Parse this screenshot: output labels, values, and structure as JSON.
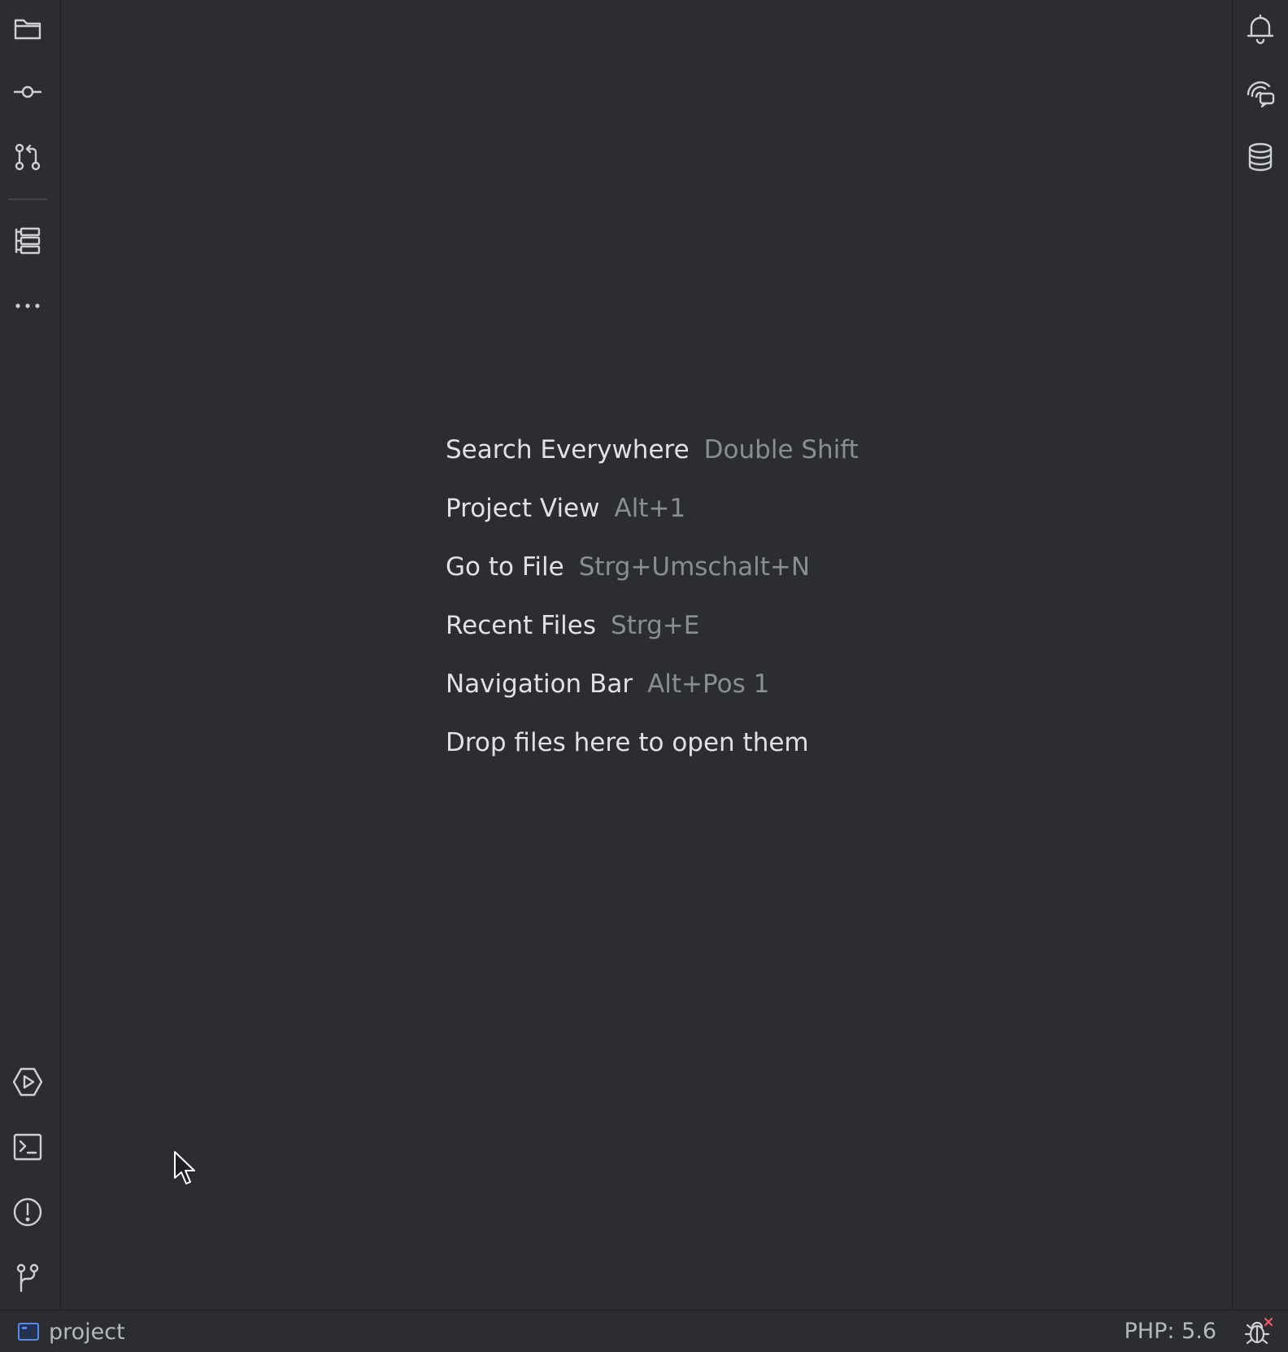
{
  "left_toolbar": {
    "top": [
      {
        "name": "project-folder-icon",
        "label": "Project"
      },
      {
        "name": "commit-icon",
        "label": "Commit"
      },
      {
        "name": "pull-requests-icon",
        "label": "Pull Requests"
      },
      {
        "name": "structure-icon",
        "label": "Structure"
      },
      {
        "name": "more-icon",
        "label": "More tool windows"
      }
    ],
    "bottom": [
      {
        "name": "services-icon",
        "label": "Services"
      },
      {
        "name": "terminal-icon",
        "label": "Terminal"
      },
      {
        "name": "problems-icon",
        "label": "Problems"
      },
      {
        "name": "git-icon",
        "label": "Git"
      }
    ]
  },
  "right_toolbar": [
    {
      "name": "notifications-icon",
      "label": "Notifications"
    },
    {
      "name": "ai-assistant-icon",
      "label": "AI Assistant"
    },
    {
      "name": "database-icon",
      "label": "Database"
    }
  ],
  "editor": {
    "hints": [
      {
        "action": "Search Everywhere",
        "shortcut": "Double Shift"
      },
      {
        "action": "Project View",
        "shortcut": "Alt+1"
      },
      {
        "action": "Go to File",
        "shortcut": "Strg+Umschalt+N"
      },
      {
        "action": "Recent Files",
        "shortcut": "Strg+E"
      },
      {
        "action": "Navigation Bar",
        "shortcut": "Alt+Pos 1"
      },
      {
        "action": "Drop files here to open them",
        "shortcut": ""
      }
    ]
  },
  "status_bar": {
    "project_name": "project",
    "php_version": "PHP: 5.6",
    "debug_icon": "debug-disabled-icon"
  },
  "colors": {
    "background": "#2b2d30",
    "text_primary": "#dfe1e5",
    "text_secondary": "#8a8d93",
    "icon": "#ced0d6",
    "accent_blue": "#548af7",
    "error_red": "#f75464"
  }
}
